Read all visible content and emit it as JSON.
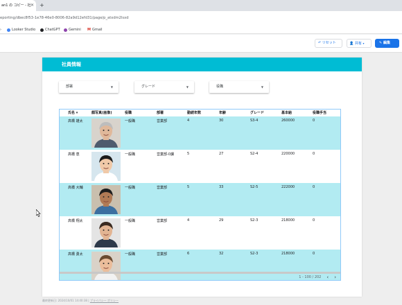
{
  "browser": {
    "tab_title": "an1 の コピー - 社",
    "url": "eporting/dbec8f53-1e78-46e0-8006-82a9d12efd31/page/p_atxdm2lsxd",
    "bookmarks": [
      "Looker Studio",
      "ChatGPT",
      "Gemini",
      "Gmail"
    ]
  },
  "toolbar": {
    "reset_label": "リセット",
    "share_label": "共有",
    "edit_label": "編集"
  },
  "report": {
    "title": "社員情報",
    "filters": [
      "部署",
      "グレード",
      "役職"
    ],
    "columns": [
      "氏名 ▾",
      "顔写真(画像)",
      "役職",
      "部署",
      "勤続年数",
      "年齢",
      "グレード",
      "基本給",
      "役職手当"
    ],
    "rows": [
      {
        "name": "高橋 雄太",
        "role": "一般職",
        "dept": "営業部",
        "years": "4",
        "age": "30",
        "grade": "S3-4",
        "salary": "260000",
        "allowance": "0",
        "avatar": "older-man",
        "highlight": true
      },
      {
        "name": "高橋 恵",
        "role": "一般職",
        "dept": "営業部-0課",
        "years": "5",
        "age": "27",
        "grade": "S2-4",
        "salary": "220000",
        "allowance": "0",
        "avatar": "woman",
        "highlight": false
      },
      {
        "name": "高橋 大輔",
        "role": "一般職",
        "dept": "営業部",
        "years": "5",
        "age": "33",
        "grade": "S2-5",
        "salary": "222000",
        "allowance": "0",
        "avatar": "man-dark",
        "highlight": true
      },
      {
        "name": "高橋 翔太",
        "role": "一般職",
        "dept": "営業部",
        "years": "4",
        "age": "29",
        "grade": "S2-3",
        "salary": "218000",
        "allowance": "0",
        "avatar": "man-glasses",
        "highlight": false
      },
      {
        "name": "高橋 勇太",
        "role": "一般職",
        "dept": "営業部",
        "years": "6",
        "age": "32",
        "grade": "S2-3",
        "salary": "218000",
        "allowance": "0",
        "avatar": "man-smile",
        "highlight": true
      }
    ],
    "pagination": "1 - 100 / 202",
    "footer_text": "最終更新日: 2024/10/01 14:40:38",
    "footer_link": "プライバシー ポリシー"
  }
}
